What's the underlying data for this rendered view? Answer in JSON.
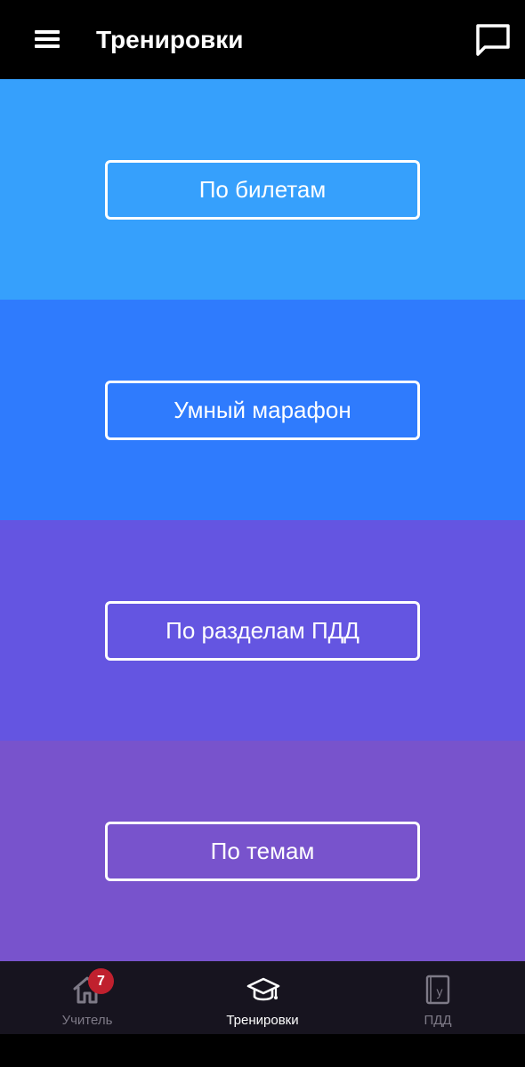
{
  "header": {
    "title": "Тренировки",
    "menu_icon": "hamburger-menu-icon",
    "chat_icon": "chat-bubble-icon"
  },
  "sections": [
    {
      "label": "По билетам",
      "color": "#36a0fc"
    },
    {
      "label": "Умный марафон",
      "color": "#2f7bfd"
    },
    {
      "label": "По разделам ПДД",
      "color": "#6455e1"
    },
    {
      "label": "По темам",
      "color": "#7853cc"
    }
  ],
  "bottom_nav": {
    "items": [
      {
        "label": "Учитель",
        "icon": "home-icon",
        "badge": "7",
        "active": false
      },
      {
        "label": "Тренировки",
        "icon": "graduation-cap-icon",
        "active": true
      },
      {
        "label": "ПДД",
        "icon": "book-icon",
        "book_letter": "у",
        "active": false
      }
    ],
    "badge_color": "#c0202e",
    "active_color": "#ffffff",
    "inactive_color": "#7e7a87"
  }
}
